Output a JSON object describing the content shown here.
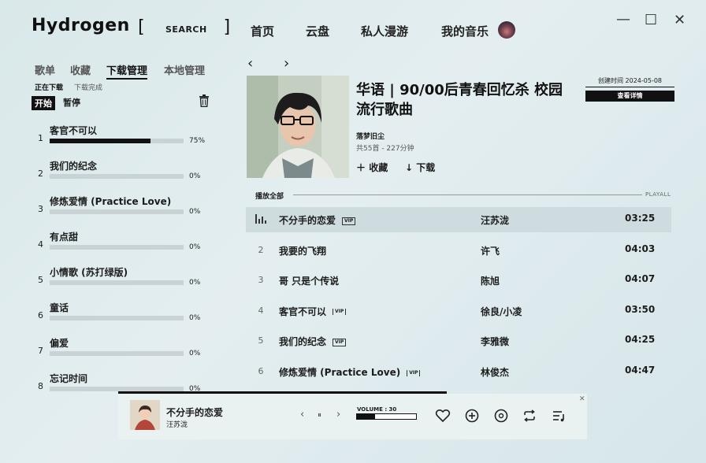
{
  "app": {
    "logo": "Hydrogen",
    "search_label": "SEARCH",
    "nav": [
      "首页",
      "云盘",
      "私人漫游",
      "我的音乐"
    ],
    "window": {
      "minimize": "—",
      "maximize": "☐",
      "close": "✕"
    }
  },
  "left": {
    "tabs": [
      "歌单",
      "收藏",
      "下载管理",
      "本地管理"
    ],
    "active_tab": "下载管理",
    "sub_tabs": [
      "正在下载",
      "下载完成"
    ],
    "start_label": "开始",
    "pause_label": "暂停",
    "downloads": [
      {
        "num": "1",
        "title": "客官不可以",
        "pct": "75%",
        "progress": 0.75
      },
      {
        "num": "2",
        "title": "我们的纪念",
        "pct": "0%",
        "progress": 0
      },
      {
        "num": "3",
        "title": "修炼爱情 (Practice Love)",
        "pct": "0%",
        "progress": 0
      },
      {
        "num": "4",
        "title": "有点甜",
        "pct": "0%",
        "progress": 0
      },
      {
        "num": "5",
        "title": "小情歌 (苏打绿版)",
        "pct": "0%",
        "progress": 0
      },
      {
        "num": "6",
        "title": "童话",
        "pct": "0%",
        "progress": 0
      },
      {
        "num": "7",
        "title": "偏爱",
        "pct": "0%",
        "progress": 0
      },
      {
        "num": "8",
        "title": "忘记时间",
        "pct": "0%",
        "progress": 0
      }
    ]
  },
  "playlist": {
    "back": "‹",
    "forward": "›",
    "title": "华语 | 90/00后青春回忆杀 校园流行歌曲",
    "author": "落梦旧尘",
    "count": "共55首 - 227分钟",
    "collect_label": "收藏",
    "download_label": "下载",
    "created": "创建时间 2024-05-08",
    "details_label": "查看详情",
    "play_all": "播放全部",
    "play_all_right": "PLAYALL",
    "vip_badge": "VIP",
    "tracks": [
      {
        "num": "1",
        "title": "不分手的恋爱",
        "artist": "汪苏泷",
        "duration": "03:25",
        "vip": "boxed",
        "current": true
      },
      {
        "num": "2",
        "title": "我要的飞翔",
        "artist": "许飞",
        "duration": "04:03",
        "vip": "none"
      },
      {
        "num": "3",
        "title": "哥 只是个传说",
        "artist": "陈旭",
        "duration": "04:07",
        "vip": "none"
      },
      {
        "num": "4",
        "title": "客官不可以",
        "artist": "徐良/小凌",
        "duration": "03:50",
        "vip": "plain"
      },
      {
        "num": "5",
        "title": "我们的纪念",
        "artist": "李雅微",
        "duration": "04:25",
        "vip": "boxed"
      },
      {
        "num": "6",
        "title": "修炼爱情 (Practice Love)",
        "artist": "林俊杰",
        "duration": "04:47",
        "vip": "plain"
      }
    ]
  },
  "player": {
    "title": "不分手的恋爱",
    "artist": "汪苏泷",
    "volume_label": "VOLUME : 30",
    "volume": 0.3,
    "progress": 0.7,
    "prev": "‹",
    "pause": "⏸",
    "next": "›",
    "close": "✕"
  },
  "colors": {
    "accent": "#111111",
    "background": "#dfeaec",
    "track_bar": "#c9d2d5"
  }
}
